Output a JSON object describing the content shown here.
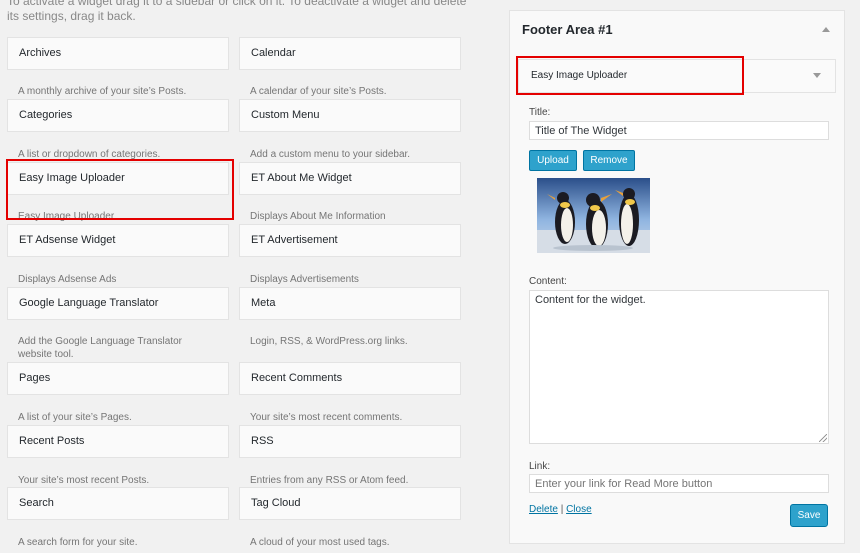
{
  "intro_text": "To activate a widget drag it to a sidebar or click on it. To deactivate a widget and delete its settings, drag it back.",
  "widgets": [
    {
      "title": "Archives",
      "desc": "A monthly archive of your site’s Posts."
    },
    {
      "title": "Calendar",
      "desc": "A calendar of your site’s Posts."
    },
    {
      "title": "Categories",
      "desc": "A list or dropdown of categories."
    },
    {
      "title": "Custom Menu",
      "desc": "Add a custom menu to your sidebar."
    },
    {
      "title": "Easy Image Uploader",
      "desc": "Easy Image Uploader"
    },
    {
      "title": "ET About Me Widget",
      "desc": "Displays About Me Information"
    },
    {
      "title": "ET Adsense Widget",
      "desc": "Displays Adsense Ads"
    },
    {
      "title": "ET Advertisement",
      "desc": "Displays Advertisements"
    },
    {
      "title": "Google Language Translator",
      "desc": "Add the Google Language Translator website tool."
    },
    {
      "title": "Meta",
      "desc": "Login, RSS, & WordPress.org links."
    },
    {
      "title": "Pages",
      "desc": "A list of your site’s Pages."
    },
    {
      "title": "Recent Comments",
      "desc": "Your site’s most recent comments."
    },
    {
      "title": "Recent Posts",
      "desc": "Your site’s most recent Posts."
    },
    {
      "title": "RSS",
      "desc": "Entries from any RSS or Atom feed."
    },
    {
      "title": "Search",
      "desc": "A search form for your site."
    },
    {
      "title": "Tag Cloud",
      "desc": "A cloud of your most used tags."
    }
  ],
  "sidebar": {
    "title": "Footer Area #1",
    "widget_title": "Easy Image Uploader",
    "title_label": "Title:",
    "title_value": "Title of The Widget",
    "upload_label": "Upload",
    "remove_label": "Remove",
    "content_label": "Content:",
    "content_value": "Content for the widget.",
    "link_label": "Link:",
    "link_placeholder": "Enter your link for Read More button",
    "delete_label": "Delete",
    "separator": "|",
    "close_label": "Close",
    "save_label": "Save"
  },
  "colors": {
    "accent": "#2ea2cc",
    "highlight": "#e40000",
    "link": "#0074a2"
  }
}
